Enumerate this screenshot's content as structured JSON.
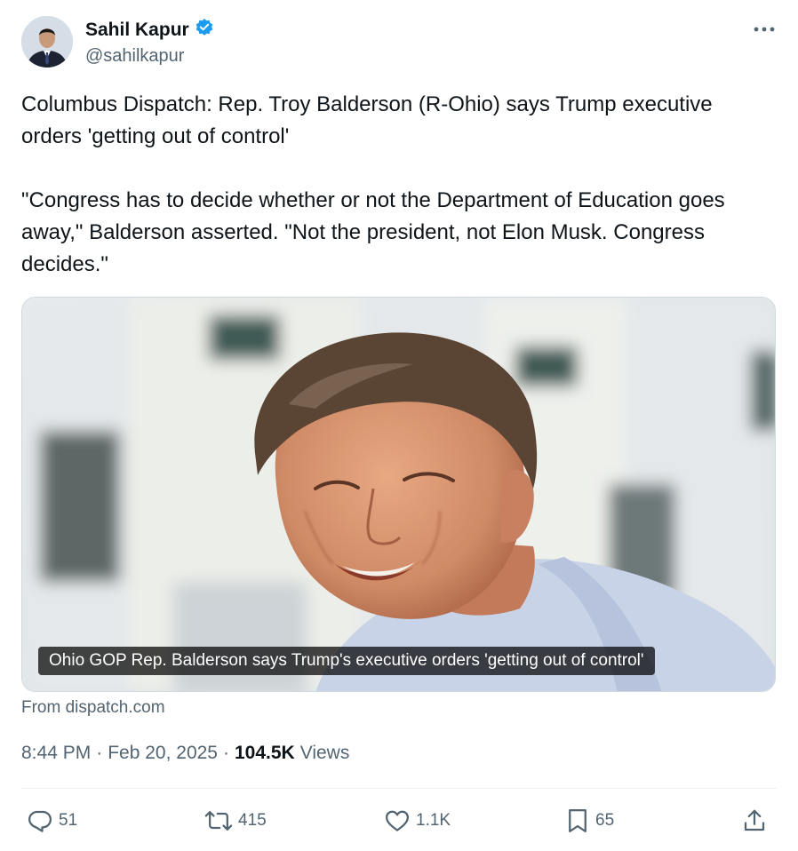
{
  "author": {
    "name": "Sahil Kapur",
    "handle": "@sahilkapur",
    "verified": true
  },
  "tweet": {
    "paragraph1": "Columbus Dispatch: Rep. Troy Balderson (R-Ohio) says Trump executive orders 'getting out of control'",
    "paragraph2": "\"Congress has to decide whether or not the Department of Education goes away,\" Balderson asserted. \"Not the president, not Elon Musk. Congress decides.\""
  },
  "card": {
    "caption": "Ohio GOP Rep. Balderson says Trump's executive orders 'getting out of control'",
    "source": "From dispatch.com"
  },
  "meta": {
    "time": "8:44 PM",
    "separator": "·",
    "date": "Feb 20, 2025",
    "views_count": "104.5K",
    "views_label": "Views"
  },
  "actions": {
    "replies": "51",
    "reposts": "415",
    "likes": "1.1K",
    "bookmarks": "65"
  },
  "colors": {
    "verified": "#1d9bf0",
    "secondary_text": "#536471",
    "primary_text": "#0f1419"
  },
  "icons": [
    "more-icon",
    "verified-badge-icon",
    "reply-icon",
    "repost-icon",
    "like-icon",
    "bookmark-icon",
    "share-icon"
  ]
}
